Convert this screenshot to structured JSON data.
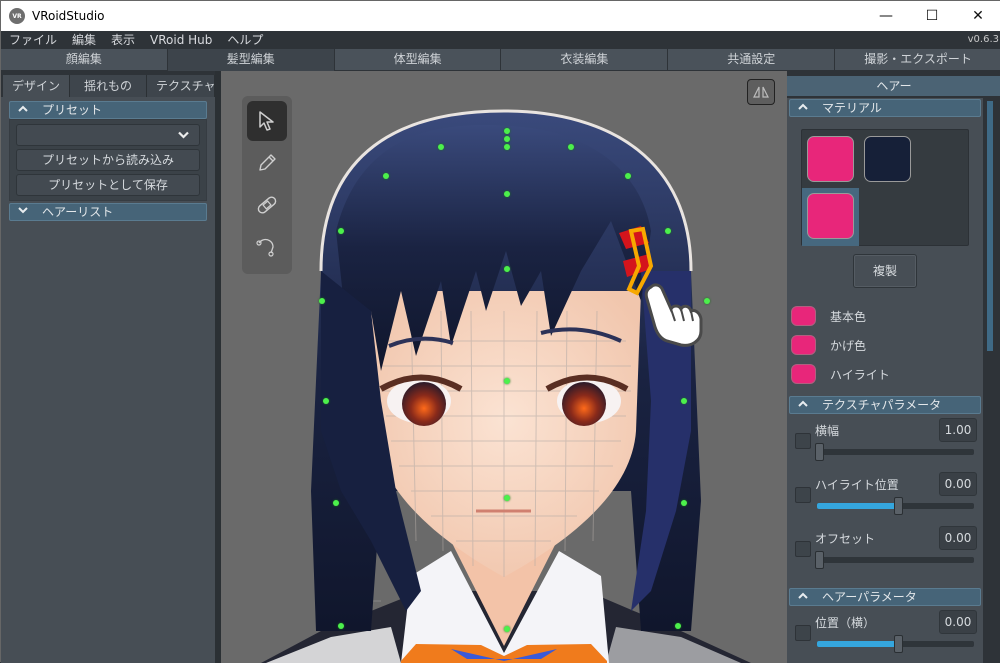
{
  "window": {
    "title": "VRoidStudio",
    "logo_text": "VR",
    "controls": {
      "minimize": "—",
      "maximize": "☐",
      "close": "✕"
    }
  },
  "menubar": {
    "items": [
      {
        "label": "ファイル"
      },
      {
        "label": "編集"
      },
      {
        "label": "表示"
      },
      {
        "label": "VRoid Hub"
      },
      {
        "label": "ヘルプ"
      }
    ],
    "version": "v0.6.3"
  },
  "main_tabs": [
    {
      "label": "顔編集",
      "active": false
    },
    {
      "label": "髪型編集",
      "active": true
    },
    {
      "label": "体型編集",
      "active": false
    },
    {
      "label": "衣装編集",
      "active": false
    },
    {
      "label": "共通設定",
      "active": false
    },
    {
      "label": "撮影・エクスポート",
      "active": false
    }
  ],
  "left_panel": {
    "tabs": [
      {
        "label": "デザイン",
        "active": true
      },
      {
        "label": "揺れもの",
        "active": false
      },
      {
        "label": "テクスチャ",
        "active": false
      }
    ],
    "preset_section": {
      "title": "プリセット",
      "expanded": true,
      "dropdown_value": "",
      "load_button": "プリセットから読み込み",
      "save_button": "プリセットとして保存"
    },
    "hair_list_section": {
      "title": "ヘアーリスト",
      "expanded": false
    }
  },
  "viewport": {
    "tools": [
      {
        "name": "select",
        "icon": "cursor-arrow-icon",
        "active": true
      },
      {
        "name": "pen",
        "icon": "pencil-icon",
        "active": false
      },
      {
        "name": "eraser",
        "icon": "bandage-icon",
        "active": false
      },
      {
        "name": "curve",
        "icon": "curve-icon",
        "active": false
      }
    ],
    "mirror_button_icon": "mirror-icon",
    "hand_cursor_icon": "pointing-hand-icon"
  },
  "right_panel": {
    "header": "ヘアー",
    "material_section": {
      "title": "マテリアル",
      "expanded": true,
      "swatches": [
        {
          "color": "#e8267a",
          "selected": false
        },
        {
          "color": "#162038",
          "selected": false
        },
        {
          "color": "#e8267a",
          "selected": true
        }
      ],
      "duplicate_button": "複製",
      "colors": [
        {
          "label": "基本色",
          "color": "#e8267a"
        },
        {
          "label": "かげ色",
          "color": "#e8267a"
        },
        {
          "label": "ハイライト",
          "color": "#e8267a"
        }
      ]
    },
    "texture_params_section": {
      "title": "テクスチャパラメータ",
      "expanded": true,
      "params": [
        {
          "label": "横幅",
          "value": "1.00",
          "slider_fraction": 0.0,
          "filled": false
        },
        {
          "label": "ハイライト位置",
          "value": "0.00",
          "slider_fraction": 0.5,
          "filled": true
        },
        {
          "label": "オフセット",
          "value": "0.00",
          "slider_fraction": 0.0,
          "filled": false
        }
      ]
    },
    "hair_params_section": {
      "title": "ヘアーパラメータ",
      "expanded": true,
      "params": [
        {
          "label": "位置（横）",
          "value": "0.00",
          "slider_fraction": 0.5,
          "filled": true
        }
      ]
    }
  },
  "colors": {
    "accent_blue": "#35a6de",
    "section_header": "#466478",
    "hair_pink": "#e8267a",
    "hair_navy": "#162038",
    "control_point_green": "#4cf04c"
  }
}
